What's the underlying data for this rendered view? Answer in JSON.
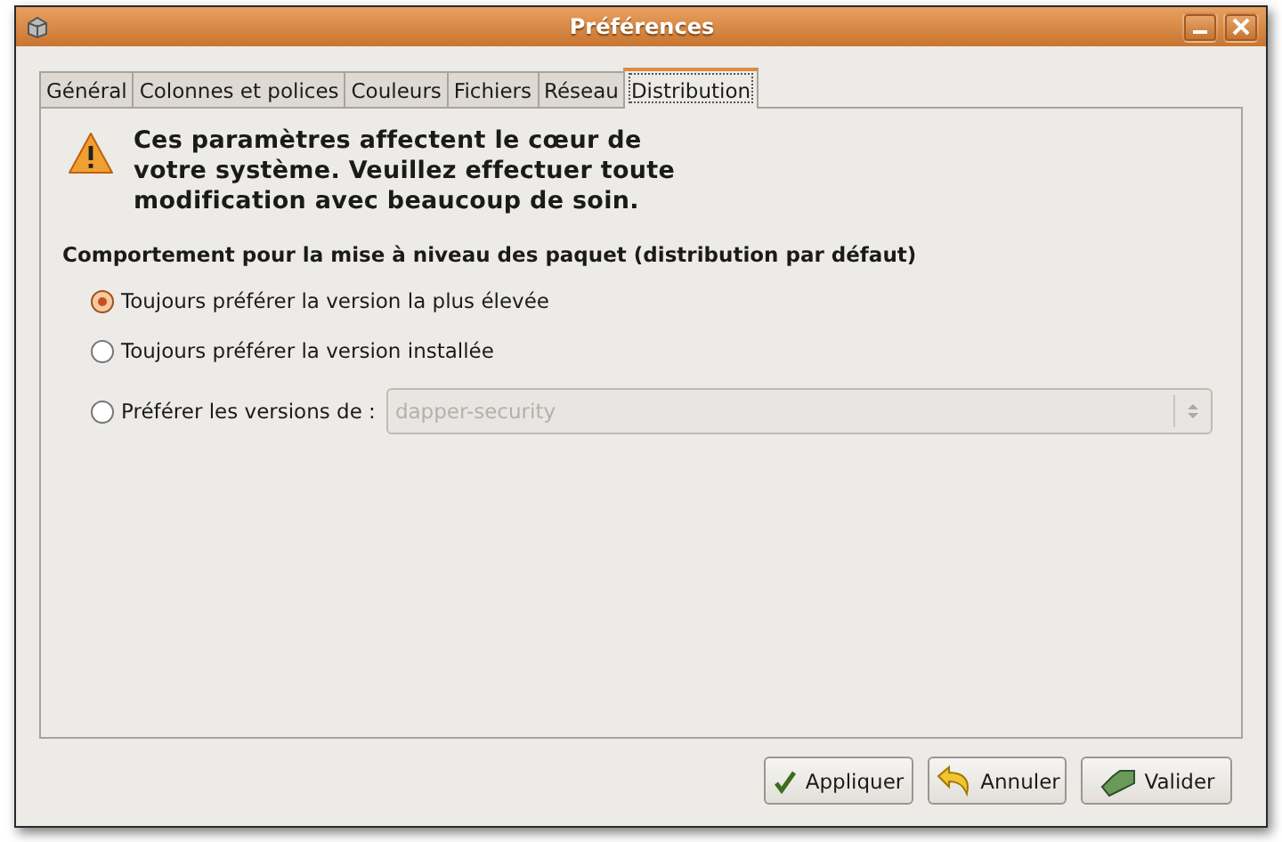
{
  "window": {
    "title": "Préférences"
  },
  "tabs": [
    {
      "label": "Général",
      "selected": false
    },
    {
      "label": "Colonnes et polices",
      "selected": false
    },
    {
      "label": "Couleurs",
      "selected": false
    },
    {
      "label": "Fichiers",
      "selected": false
    },
    {
      "label": "Réseau",
      "selected": false
    },
    {
      "label": "Distribution",
      "selected": true
    }
  ],
  "warning": "Ces paramètres affectent le cœur de votre système. Veuillez effectuer toute modification avec beaucoup de soin.",
  "section": {
    "title": "Comportement pour la mise à niveau des paquet (distribution par défaut)",
    "options": [
      {
        "label": "Toujours préférer la version la plus élevée",
        "selected": true
      },
      {
        "label": "Toujours préférer la version installée",
        "selected": false
      },
      {
        "label": "Préférer les versions de :",
        "selected": false,
        "dropdown": {
          "value": "dapper-security",
          "disabled": true
        }
      }
    ]
  },
  "buttons": [
    {
      "label": "Appliquer",
      "kind": "apply"
    },
    {
      "label": "Annuler",
      "kind": "cancel"
    },
    {
      "label": "Valider",
      "kind": "ok"
    }
  ]
}
